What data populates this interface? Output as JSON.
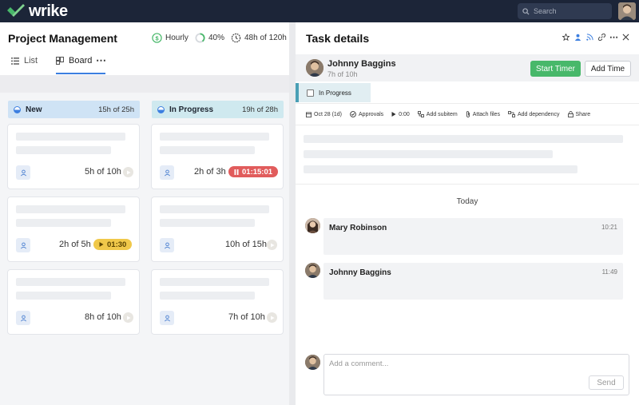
{
  "app": {
    "logo_text": "wrike",
    "brand_color": "#48b86a",
    "topbar_color": "#1c2538"
  },
  "search": {
    "placeholder": "Search"
  },
  "project": {
    "title": "Project Management",
    "billing_label": "Hourly",
    "progress_label": "40%",
    "time_label": "48h of 120h"
  },
  "view_tabs": [
    {
      "label": "List",
      "icon": "list-icon",
      "active": false
    },
    {
      "label": "Board",
      "icon": "board-icon",
      "active": true
    }
  ],
  "board": {
    "columns": [
      {
        "label": "New",
        "count": "15h of 25h",
        "color": "#cfe3f5",
        "cards": [
          {
            "hours": "5h of 10h",
            "timer": null
          },
          {
            "hours": "2h of 5h",
            "timer": "01:30",
            "timer_state": "paused"
          },
          {
            "hours": "8h of 10h",
            "timer": null
          }
        ]
      },
      {
        "label": "In Progress",
        "count": "19h of 28h",
        "color": "#cfe9ef",
        "cards": [
          {
            "hours": "2h of 3h",
            "timer": "01:15:01",
            "timer_state": "running"
          },
          {
            "hours": "10h of 15h",
            "timer": null
          },
          {
            "hours": "7h of 10h",
            "timer": null
          }
        ]
      }
    ]
  },
  "task": {
    "panel_title": "Task details",
    "assignee_name": "Johnny Baggins",
    "assignee_time": "7h of 10h",
    "start_timer_label": "Start Timer",
    "add_time_label": "Add Time",
    "status_label": "In Progress",
    "toolbar": {
      "date": "Oct 28 (1d)",
      "approvals": "Approvals",
      "timer": "0:00",
      "add_subitem": "Add subitem",
      "attach_files": "Attach files",
      "add_dependency": "Add dependency",
      "share": "Share"
    }
  },
  "activity": {
    "day_label": "Today",
    "comments": [
      {
        "author": "Mary Robinson",
        "time": "10:21"
      },
      {
        "author": "Johnny Baggins",
        "time": "11:49"
      }
    ],
    "comment_placeholder": "Add a comment...",
    "send_label": "Send"
  }
}
